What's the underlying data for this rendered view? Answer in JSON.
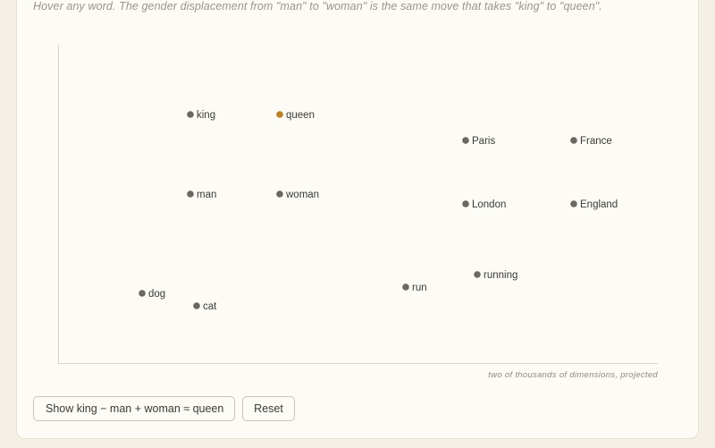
{
  "hint": "Hover any word. The gender displacement from \"man\" to \"woman\" is the same move that takes \"king\" to \"queen\".",
  "axis_caption": "two of thousands of dimensions, projected",
  "buttons": {
    "show_label": "Show king − man + woman ≈ queen",
    "reset_label": "Reset"
  },
  "colors": {
    "point": "#6b6863",
    "highlight": "#b8802a",
    "axis": "#d8d3c8"
  },
  "words": [
    {
      "id": "king",
      "label": "king",
      "highlight": false
    },
    {
      "id": "queen",
      "label": "queen",
      "highlight": true
    },
    {
      "id": "paris",
      "label": "Paris",
      "highlight": false
    },
    {
      "id": "france",
      "label": "France",
      "highlight": false
    },
    {
      "id": "man",
      "label": "man",
      "highlight": false
    },
    {
      "id": "woman",
      "label": "woman",
      "highlight": false
    },
    {
      "id": "london",
      "label": "London",
      "highlight": false
    },
    {
      "id": "england",
      "label": "England",
      "highlight": false
    },
    {
      "id": "running",
      "label": "running",
      "highlight": false
    },
    {
      "id": "run",
      "label": "run",
      "highlight": false
    },
    {
      "id": "dog",
      "label": "dog",
      "highlight": false
    },
    {
      "id": "cat",
      "label": "cat",
      "highlight": false
    }
  ]
}
